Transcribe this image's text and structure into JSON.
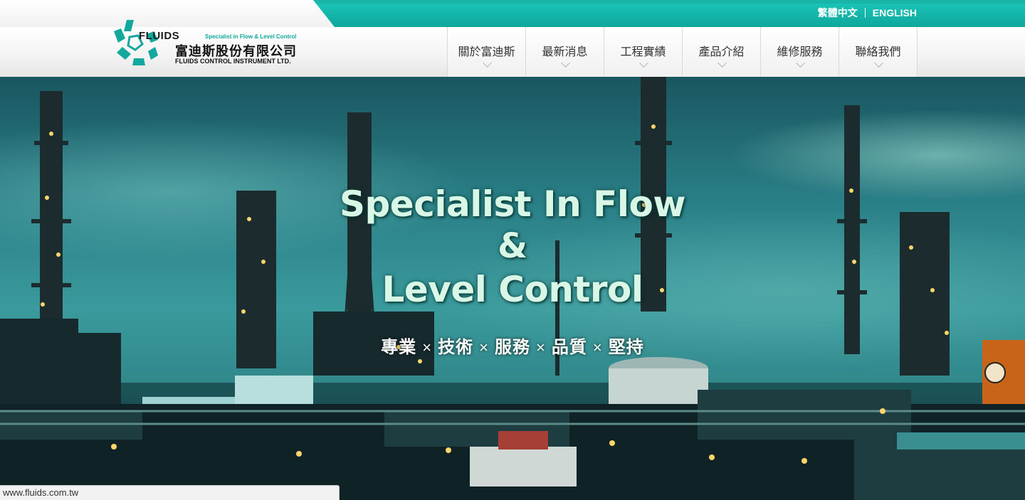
{
  "language_switch": {
    "traditional_chinese": "繁體中文",
    "english": "ENGLISH"
  },
  "logo": {
    "brand": "FLUIDS",
    "tagline": "Specialist in Flow & Level Control",
    "company_name_zh": "富迪斯股份有限公司",
    "company_name_en": "FLUIDS CONTROL INSTRUMENT LTD."
  },
  "nav": {
    "items": [
      {
        "label": "關於富迪斯"
      },
      {
        "label": "最新消息"
      },
      {
        "label": "工程實績"
      },
      {
        "label": "產品介紹"
      },
      {
        "label": "維修服務"
      },
      {
        "label": "聯絡我們"
      }
    ]
  },
  "hero": {
    "headline_line1": "Specialist In Flow",
    "headline_line2": "&",
    "headline_line3": "Level Control",
    "slogan": [
      "專業",
      "技術",
      "服務",
      "品質",
      "堅持"
    ],
    "slogan_separator": "×"
  },
  "status_bar": {
    "url": "www.fluids.com.tw"
  },
  "colors": {
    "accent": "#11a89d",
    "topband": "#1cc7bb"
  }
}
